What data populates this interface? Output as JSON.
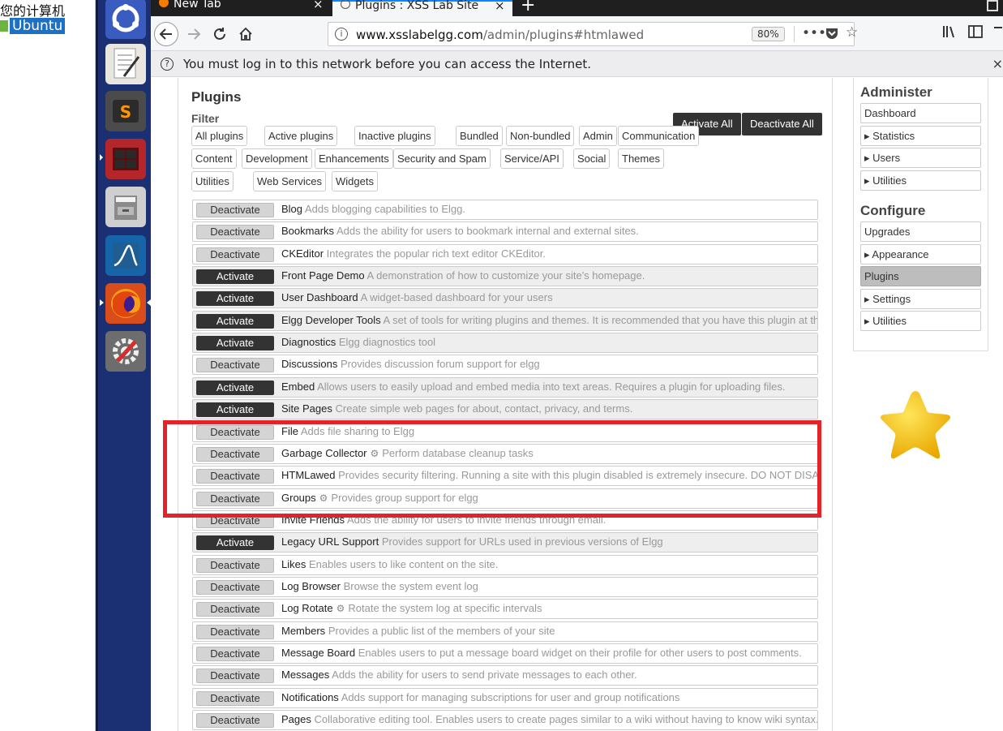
{
  "desktop": {
    "line1": "您的计算机",
    "line2": "Ubuntu"
  },
  "launcher": {
    "icons": [
      "ubuntu-logo-icon",
      "text-editor-icon",
      "sublime-text-icon",
      "terminal-icon",
      "file-manager-icon",
      "wireshark-icon",
      "firefox-icon",
      "system-settings-icon"
    ]
  },
  "browser": {
    "tabs": [
      {
        "title": "New Tab",
        "close": "×"
      },
      {
        "title": "Plugins : XSS Lab Site",
        "close": "×"
      }
    ],
    "new_tab": "+",
    "url_domain": "www.xsslabelgg.com",
    "url_path": "/admin/plugins#htmlawed",
    "zoom": "80%",
    "notice": "You must log in to this network before you can access the Internet.",
    "notice_close": "×"
  },
  "page": {
    "title": "Plugins",
    "filter_label": "Filter",
    "activate_all": "Activate All",
    "deactivate_all": "Deactivate All",
    "filters_row1": [
      "All plugins",
      "Active plugins",
      "Inactive plugins",
      "Bundled",
      "Non-bundled",
      "Admin",
      "Communication"
    ],
    "filters_row2": [
      "Content",
      "Development",
      "Enhancements",
      "Security and Spam",
      "Service/API",
      "Social",
      "Themes"
    ],
    "filters_row3": [
      "Utilities",
      "Web Services",
      "Widgets"
    ],
    "plugins": [
      {
        "action": "Deactivate",
        "name": "Blog",
        "gear": false,
        "desc": "Adds blogging capabilities to Elgg."
      },
      {
        "action": "Deactivate",
        "name": "Bookmarks",
        "gear": false,
        "desc": "Adds the ability for users to bookmark internal and external sites."
      },
      {
        "action": "Deactivate",
        "name": "CKEditor",
        "gear": false,
        "desc": "Integrates the popular rich text editor CKEditor."
      },
      {
        "action": "Activate",
        "name": "Front Page Demo",
        "gear": false,
        "desc": "A demonstration of how to customize your site's homepage."
      },
      {
        "action": "Activate",
        "name": "User Dashboard",
        "gear": false,
        "desc": "A widget-based dashboard for your users"
      },
      {
        "action": "Activate",
        "name": "Elgg Developer Tools",
        "gear": false,
        "desc": "A set of tools for writing plugins and themes. It is recommended that you have this plugin at the top c"
      },
      {
        "action": "Activate",
        "name": "Diagnostics",
        "gear": false,
        "desc": "Elgg diagnostics tool"
      },
      {
        "action": "Deactivate",
        "name": "Discussions",
        "gear": false,
        "desc": "Provides discussion forum support for elgg"
      },
      {
        "action": "Activate",
        "name": "Embed",
        "gear": false,
        "desc": "Allows users to easily upload and embed media into text areas. Requires a plugin for uploading files."
      },
      {
        "action": "Activate",
        "name": "Site Pages",
        "gear": false,
        "desc": "Create simple web pages for about, contact, privacy, and terms."
      },
      {
        "action": "Deactivate",
        "name": "File",
        "gear": false,
        "desc": "Adds file sharing to Elgg"
      },
      {
        "action": "Deactivate",
        "name": "Garbage Collector",
        "gear": true,
        "desc": "Perform database cleanup tasks"
      },
      {
        "action": "Deactivate",
        "name": "HTMLawed",
        "gear": false,
        "desc": "Provides security filtering. Running a site with this plugin disabled is extremely insecure. DO NOT DISABLE."
      },
      {
        "action": "Deactivate",
        "name": "Groups",
        "gear": true,
        "desc": "Provides group support for elgg"
      },
      {
        "action": "Deactivate",
        "name": "Invite Friends",
        "gear": false,
        "desc": "Adds the ability for users to invite friends through email."
      },
      {
        "action": "Activate",
        "name": "Legacy URL Support",
        "gear": false,
        "desc": "Provides support for URLs used in previous versions of Elgg"
      },
      {
        "action": "Deactivate",
        "name": "Likes",
        "gear": false,
        "desc": "Enables users to like content on the site."
      },
      {
        "action": "Deactivate",
        "name": "Log Browser",
        "gear": false,
        "desc": "Browse the system event log"
      },
      {
        "action": "Deactivate",
        "name": "Log Rotate",
        "gear": true,
        "desc": "Rotate the system log at specific intervals"
      },
      {
        "action": "Deactivate",
        "name": "Members",
        "gear": false,
        "desc": "Provides a public list of the members of your site"
      },
      {
        "action": "Deactivate",
        "name": "Message Board",
        "gear": false,
        "desc": "Enables users to put a message board widget on their profile for other users to post comments."
      },
      {
        "action": "Deactivate",
        "name": "Messages",
        "gear": false,
        "desc": "Adds the ability for users to send private messages to each other."
      },
      {
        "action": "Deactivate",
        "name": "Notifications",
        "gear": false,
        "desc": "Adds support for managing subscriptions for user and group notifications"
      },
      {
        "action": "Deactivate",
        "name": "Pages",
        "gear": false,
        "desc": "Collaborative editing tool. Enables users to create pages similar to a wiki without having to know wiki syntax."
      }
    ]
  },
  "sidebar": {
    "administer_title": "Administer",
    "administer_items": [
      "Dashboard",
      "▸ Statistics",
      "▸ Users",
      "▸ Utilities"
    ],
    "configure_title": "Configure",
    "configure_items": [
      "Upgrades",
      "▸ Appearance",
      "Plugins",
      "▸ Settings",
      "▸ Utilities"
    ],
    "selected_item": "Plugins"
  },
  "colors": {
    "highlight_box": "#e3222a",
    "launcher_bg": "#1b2f73",
    "button_dark": "#333333",
    "star": "#f5c400"
  }
}
